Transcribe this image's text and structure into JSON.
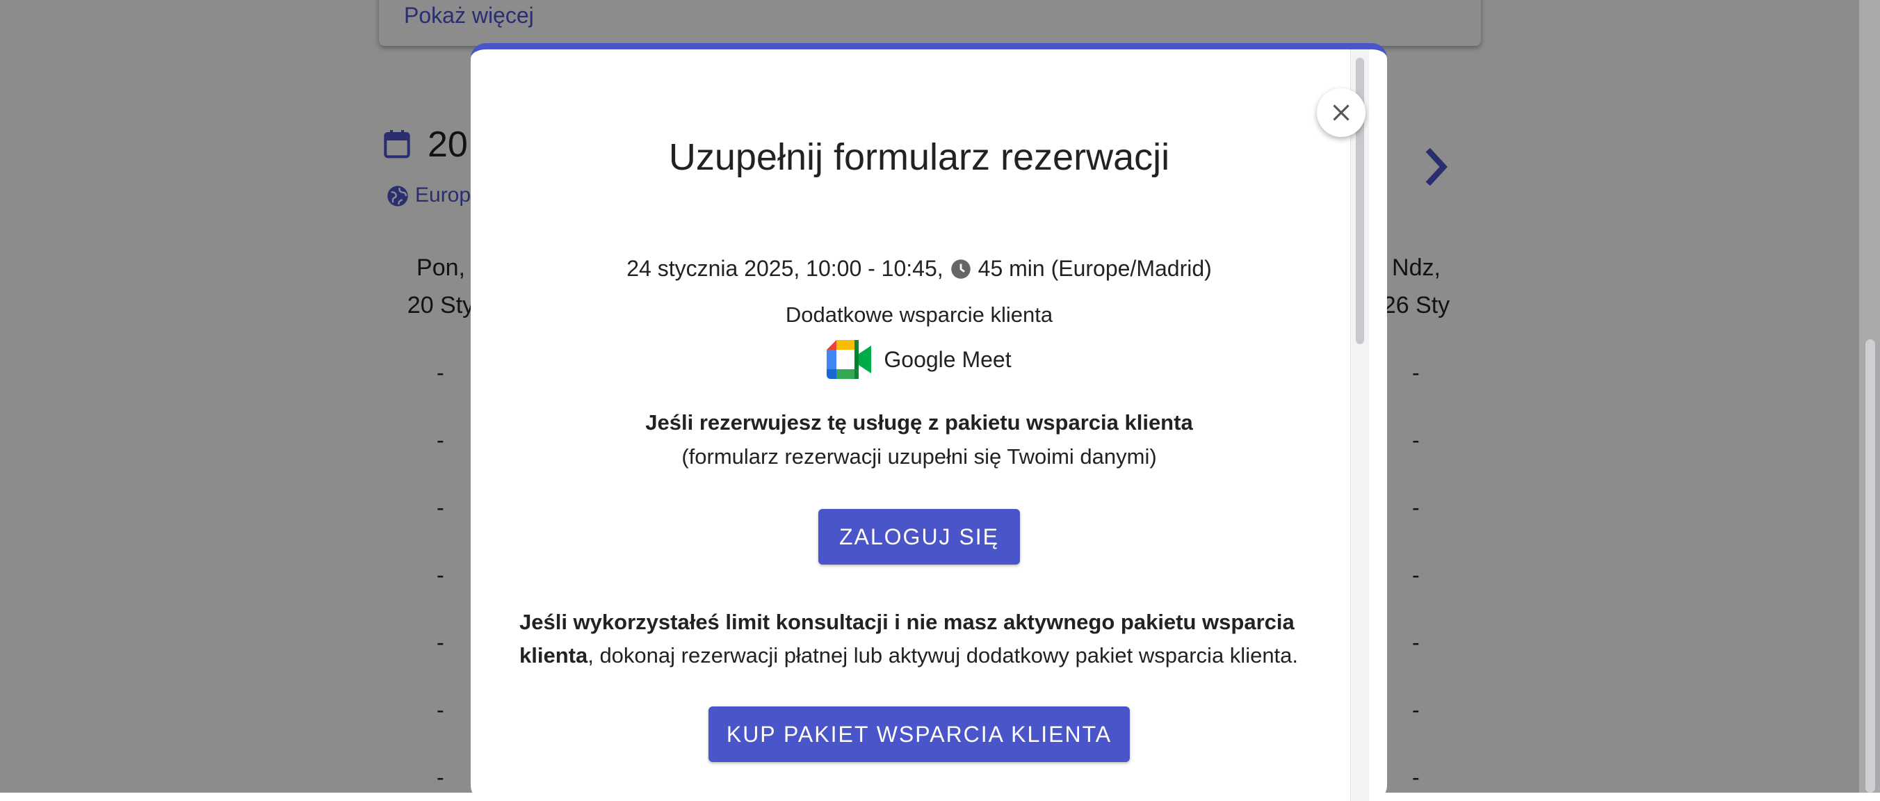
{
  "background": {
    "show_more_link": "Pokaż więcej",
    "date_heading": "20",
    "timezone_label": "Europ",
    "day_left": {
      "weekday": "Pon,",
      "date": "20 Sty"
    },
    "day_right": {
      "weekday": "Ndz,",
      "date": "26 Sty"
    },
    "slot_placeholder": "-"
  },
  "modal": {
    "title": "Uzupełnij formularz rezerwacji",
    "datetime": "24 stycznia 2025, 10:00 - 10:45,",
    "duration": "45 min (Europe/Madrid)",
    "service_name": "Dodatkowe wsparcie klienta",
    "platform": "Google Meet",
    "package_note_bold": "Jeśli rezerwujesz tę usługę z pakietu wsparcia klienta",
    "package_note": "(formularz rezerwacji uzupełni się Twoimi danymi)",
    "login_button": "ZALOGUJ SIĘ",
    "limit_note_bold": "Jeśli wykorzystałeś limit konsultacji i nie masz aktywnego pakietu wsparcia klienta",
    "limit_note_rest": ", dokonaj rezerwacji płatnej lub aktywuj dodatkowy pakiet wsparcia klienta.",
    "buy_button": "KUP PAKIET WSPARCIA KLIENTA"
  },
  "colors": {
    "accent": "#4a55c9",
    "overlay": "rgba(0,0,0,0.45)"
  },
  "icons": [
    "calendar-icon",
    "globe-icon",
    "chevron-right-icon",
    "close-icon",
    "clock-icon",
    "google-meet-icon"
  ]
}
